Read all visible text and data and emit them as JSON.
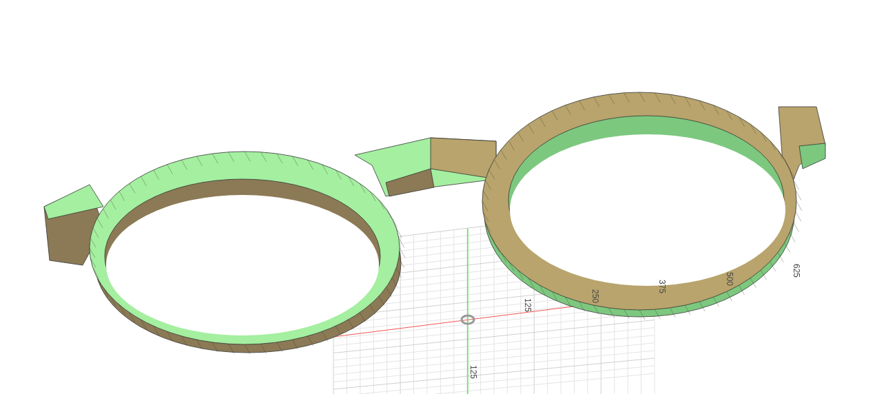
{
  "viewport": {
    "x_axis_ticks": [
      "125",
      "250",
      "375",
      "500",
      "625"
    ],
    "y_axis_ticks": [
      "125"
    ]
  }
}
